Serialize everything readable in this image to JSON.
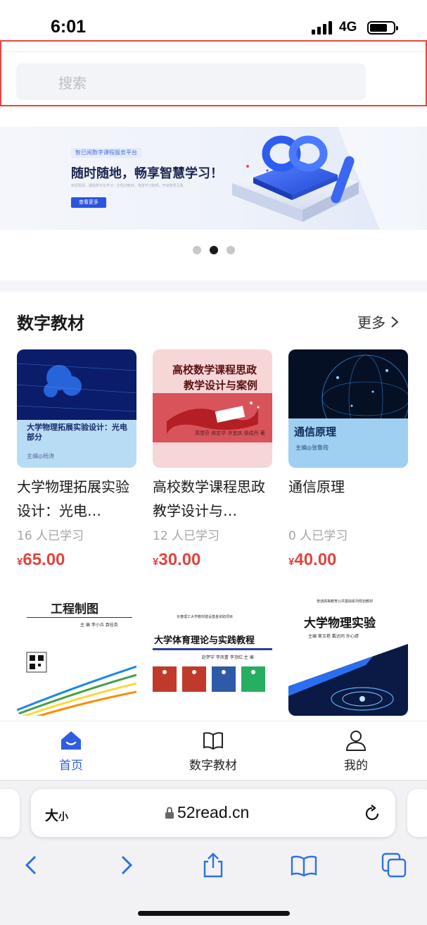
{
  "status_bar": {
    "time": "6:01",
    "network": "4G"
  },
  "search": {
    "placeholder": "搜索"
  },
  "banner": {
    "tag": "智已阅数字课程服务平台",
    "headline": "随时随地，畅享智慧学习！",
    "subtext": "有经费源，偶能数字化学习 · 正轻识教材，课堂学习随现，开启智慧互联",
    "button": "查看更多",
    "page_dots": 3,
    "active_dot": 1
  },
  "section": {
    "title": "数字教材",
    "more": "更多"
  },
  "books": [
    {
      "title": "大学物理拓展实验设计：光电…",
      "learners": "16 人已学习",
      "currency": "¥",
      "price": "65.00",
      "cover_title": "大学物理拓展实验设计：光电部分",
      "cover_editor": "主编◎杨涛"
    },
    {
      "title": "高校数学课程思政教学设计与…",
      "learners": "12 人已学习",
      "currency": "¥",
      "price": "30.00",
      "cover_title_l1": "高校数学课程思政",
      "cover_title_l2": "教学设计与案例",
      "cover_authors": "高雪芬 徐定华 许宜庆 徐成丹 著"
    },
    {
      "title": "通信原理",
      "learners": "0 人已学习",
      "currency": "¥",
      "price": "40.00",
      "cover_title": "通信原理",
      "cover_editor": "主编◎张鲁筠"
    },
    {
      "title": "工程制图",
      "cover_title": "工程制图",
      "cover_editor": "主 编 李小兵 袁桂英"
    },
    {
      "title": "大学体育理论与实践教程",
      "cover_top": "长春理工大学教材建设基金资助项目",
      "cover_title": "大学体育理论与实践教程",
      "cover_editor": "赵梦宇 李凤蕾 李顶红 主 编"
    },
    {
      "title": "大学物理实验",
      "cover_top": "普通高等教育公共基础系列规划教材",
      "cover_title": "大学物理实验",
      "cover_editor": "主编 崔玉艳 戴达同 孙心靖"
    }
  ],
  "tab_bar": [
    {
      "label": "首页",
      "icon": "home-icon",
      "active": true
    },
    {
      "label": "数字教材",
      "icon": "book-icon",
      "active": false
    },
    {
      "label": "我的",
      "icon": "person-icon",
      "active": false
    }
  ],
  "safari": {
    "text_size": "大",
    "text_size_small": "小",
    "url": "52read.cn"
  },
  "colors": {
    "accent": "#2f5fe0",
    "price": "#e0463f",
    "highlight_border": "#e8463f"
  }
}
